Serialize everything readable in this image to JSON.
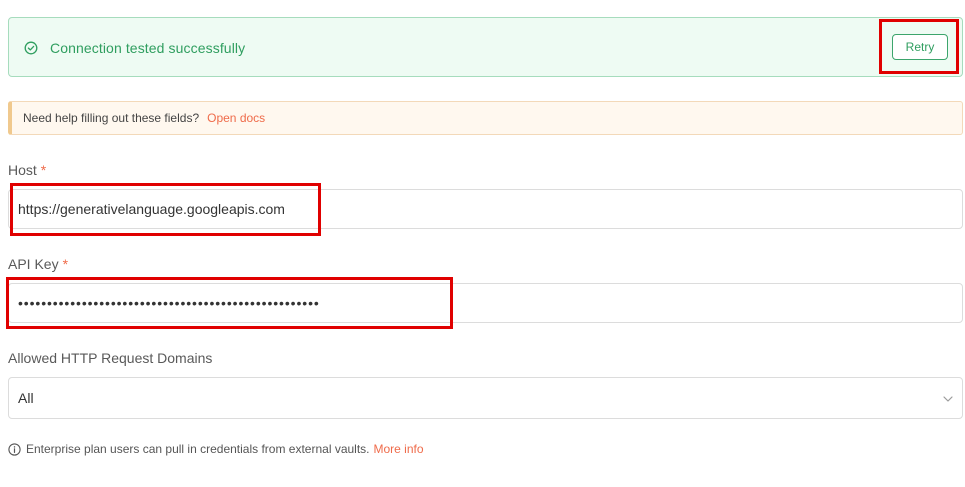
{
  "status_banner": {
    "message": "Connection tested successfully",
    "retry_label": "Retry",
    "icon": "check-circle-icon",
    "color": "#2f9e5f"
  },
  "help": {
    "text": "Need help filling out these fields?",
    "link_label": "Open docs"
  },
  "fields": {
    "host": {
      "label": "Host",
      "required_mark": "*",
      "value": "https://generativelanguage.googleapis.com"
    },
    "api_key": {
      "label": "API Key",
      "required_mark": "*",
      "masked_value": "••••••••••••••••••••••••••••••••••••••••••••••••••••"
    },
    "allowed_domains": {
      "label": "Allowed HTTP Request Domains",
      "selected": "All"
    }
  },
  "footer": {
    "text": "Enterprise plan users can pull in credentials from external vaults.",
    "link_label": "More info",
    "icon": "info-icon"
  },
  "colors": {
    "accent_link": "#ef6b4a",
    "success": "#2f9e5f",
    "highlight": "#e00000"
  }
}
